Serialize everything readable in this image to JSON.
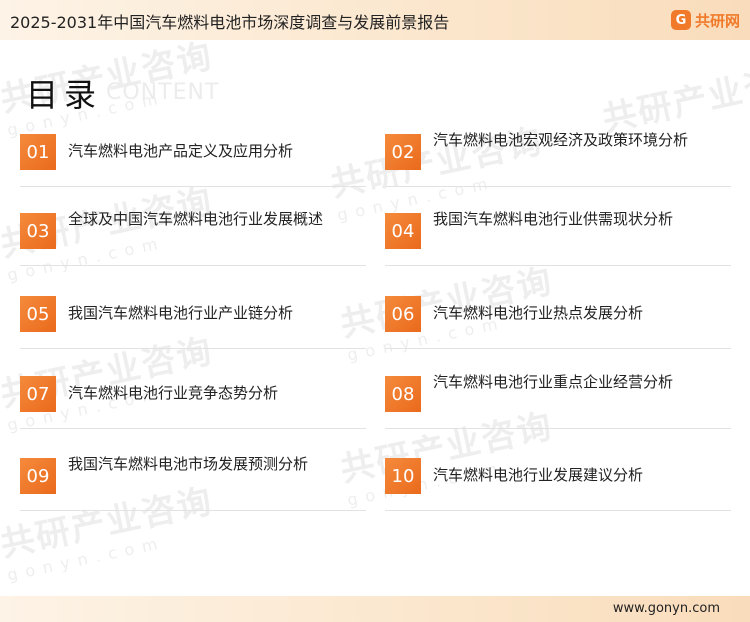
{
  "header": {
    "title": "2025-2031年中国汽车燃料电池市场深度调查与发展前景报告"
  },
  "logo": {
    "mark": "G",
    "text": "共研网"
  },
  "toc": {
    "title": "目录",
    "subtitle": "CONTENT"
  },
  "watermark": {
    "text": "共研产业咨询",
    "domain": "gonyn.com"
  },
  "items": [
    {
      "num": "01",
      "label": "汽车燃料电池产品定义及应用分析"
    },
    {
      "num": "02",
      "label": "汽车燃料电池宏观经济及政策环境分析"
    },
    {
      "num": "03",
      "label": "全球及中国汽车燃料电池行业发展概述"
    },
    {
      "num": "04",
      "label": "我国汽车燃料电池行业供需现状分析"
    },
    {
      "num": "05",
      "label": "我国汽车燃料电池行业产业链分析"
    },
    {
      "num": "06",
      "label": "汽车燃料电池行业热点发展分析"
    },
    {
      "num": "07",
      "label": "汽车燃料电池行业竞争态势分析"
    },
    {
      "num": "08",
      "label": "汽车燃料电池行业重点企业经营分析"
    },
    {
      "num": "09",
      "label": "我国汽车燃料电池市场发展预测分析"
    },
    {
      "num": "10",
      "label": "汽车燃料电池行业发展建议分析"
    }
  ],
  "footer": {
    "url": "www.gonyn.com"
  },
  "colors": {
    "accent": "#ef7524",
    "header_bg": "#fbe6cc"
  }
}
